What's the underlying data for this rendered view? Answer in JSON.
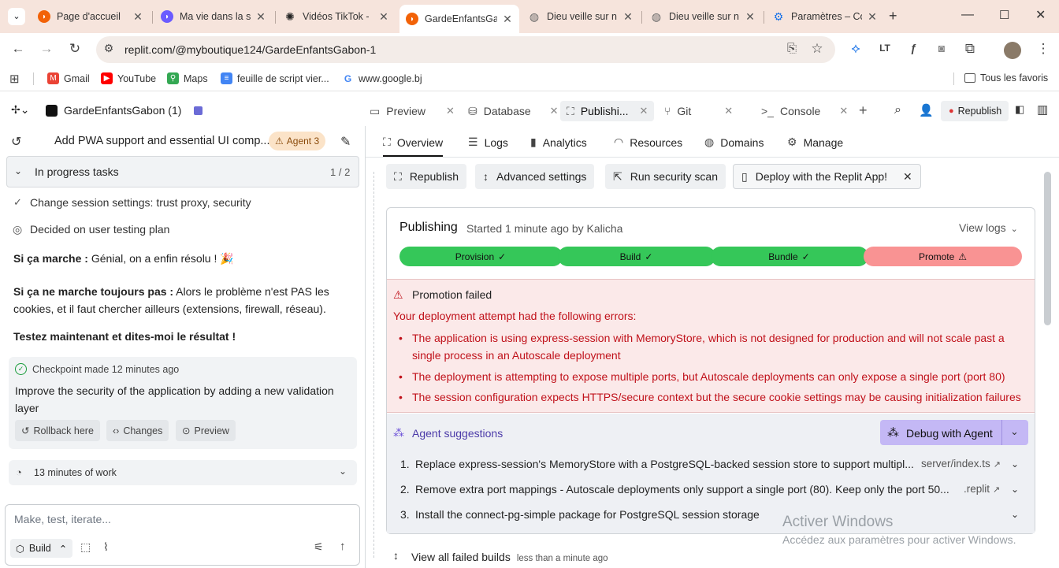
{
  "browser": {
    "tabs": [
      {
        "title": "Page d'accueil",
        "icon": "replit-tab-icon",
        "color": "#f26207"
      },
      {
        "title": "Ma vie dans la s",
        "icon": "replit-tab-icon",
        "color": "#6b5bff"
      },
      {
        "title": "Vidéos TikTok -",
        "icon": "openai-tab-icon",
        "color": "#222"
      },
      {
        "title": "GardeEnfantsGa",
        "icon": "replit-tab-icon",
        "color": "#f26207"
      },
      {
        "title": "Dieu veille sur n",
        "icon": "globe-tab-icon",
        "color": "#777"
      },
      {
        "title": "Dieu veille sur n",
        "icon": "globe-tab-icon",
        "color": "#777"
      },
      {
        "title": "Paramètres – Co",
        "icon": "gear-tab-icon",
        "color": "#1a73e8"
      }
    ],
    "url": "replit.com/@myboutique124/GardeEnfantsGabon-1",
    "bookmarks": [
      {
        "label": "Gmail",
        "color": "#ea4335"
      },
      {
        "label": "YouTube",
        "color": "#ff0000"
      },
      {
        "label": "Maps",
        "color": "#34a853"
      },
      {
        "label": "feuille de script vier...",
        "color": "#4285f4"
      },
      {
        "label": "www.google.bj",
        "color": "#4285f4"
      }
    ],
    "all_bookmarks": "Tous les favoris"
  },
  "replit": {
    "project": "GardeEnfantsGabon (1)",
    "tabs": [
      "Preview",
      "Database",
      "Publishi...",
      "Git",
      "Console"
    ],
    "republish": "Republish"
  },
  "left": {
    "thread_title": "Add PWA support and essential UI comp...",
    "agent_badge": "Agent 3",
    "progress_label": "In progress tasks",
    "progress_count": "1 / 2",
    "task1": "Change session settings: trust proxy, security",
    "task2": "Decided on user testing plan",
    "msg1_bold": "Si ça marche :",
    "msg1_rest": " Génial, on a enfin résolu ! 🎉",
    "msg2_bold": "Si ça ne marche toujours pas :",
    "msg2_rest": " Alors le problème n'est PAS les cookies, et il faut chercher ailleurs (extensions, firewall, réseau).",
    "msg3": "Testez maintenant et dites-moi le résultat !",
    "checkpoint": "Checkpoint made 12 minutes ago",
    "checkpoint_desc": "Improve the security of the application by adding a new validation layer",
    "rollback": "Rollback here",
    "changes": "Changes",
    "preview": "Preview",
    "work": "13 minutes of work",
    "input_placeholder": "Make, test, iterate...",
    "build": "Build"
  },
  "right": {
    "subnav": [
      "Overview",
      "Logs",
      "Analytics",
      "Resources",
      "Domains",
      "Manage"
    ],
    "actions": [
      "Republish",
      "Advanced settings",
      "Run security scan",
      "Deploy with the Replit App!"
    ],
    "publishing": "Publishing",
    "started": "Started 1 minute ago by Kalicha",
    "view_logs": "View logs",
    "steps": [
      {
        "label": "Provision",
        "status": "done"
      },
      {
        "label": "Build",
        "status": "done"
      },
      {
        "label": "Bundle",
        "status": "done"
      },
      {
        "label": "Promote",
        "status": "failed"
      }
    ],
    "promotion_failed": "Promotion failed",
    "errors_intro": "Your deployment attempt had the following errors:",
    "errors": [
      "The application is using express-session with MemoryStore, which is not designed for production and will not scale past a single process in an Autoscale deployment",
      "The deployment is attempting to expose multiple ports, but Autoscale deployments can only expose a single port (port 80)",
      "The session configuration expects HTTPS/secure context but the secure cookie settings may be causing initialization failures"
    ],
    "agent_suggestions": "Agent suggestions",
    "debug": "Debug with Agent",
    "suggestions": [
      {
        "n": "1.",
        "text": "Replace express-session's MemoryStore with a PostgreSQL-backed session store to support multipl...",
        "file": "server/index.ts"
      },
      {
        "n": "2.",
        "text": "Remove extra port mappings - Autoscale deployments only support a single port (80). Keep only the port 50...",
        "file": ".replit"
      },
      {
        "n": "3.",
        "text": "Install the connect-pg-simple package for PostgreSQL session storage",
        "file": ""
      }
    ],
    "view_failed": "View all failed builds",
    "view_failed_time": "less than a minute ago",
    "activate_title": "Activer Windows",
    "activate_sub": "Accédez aux paramètres pour activer Windows."
  }
}
